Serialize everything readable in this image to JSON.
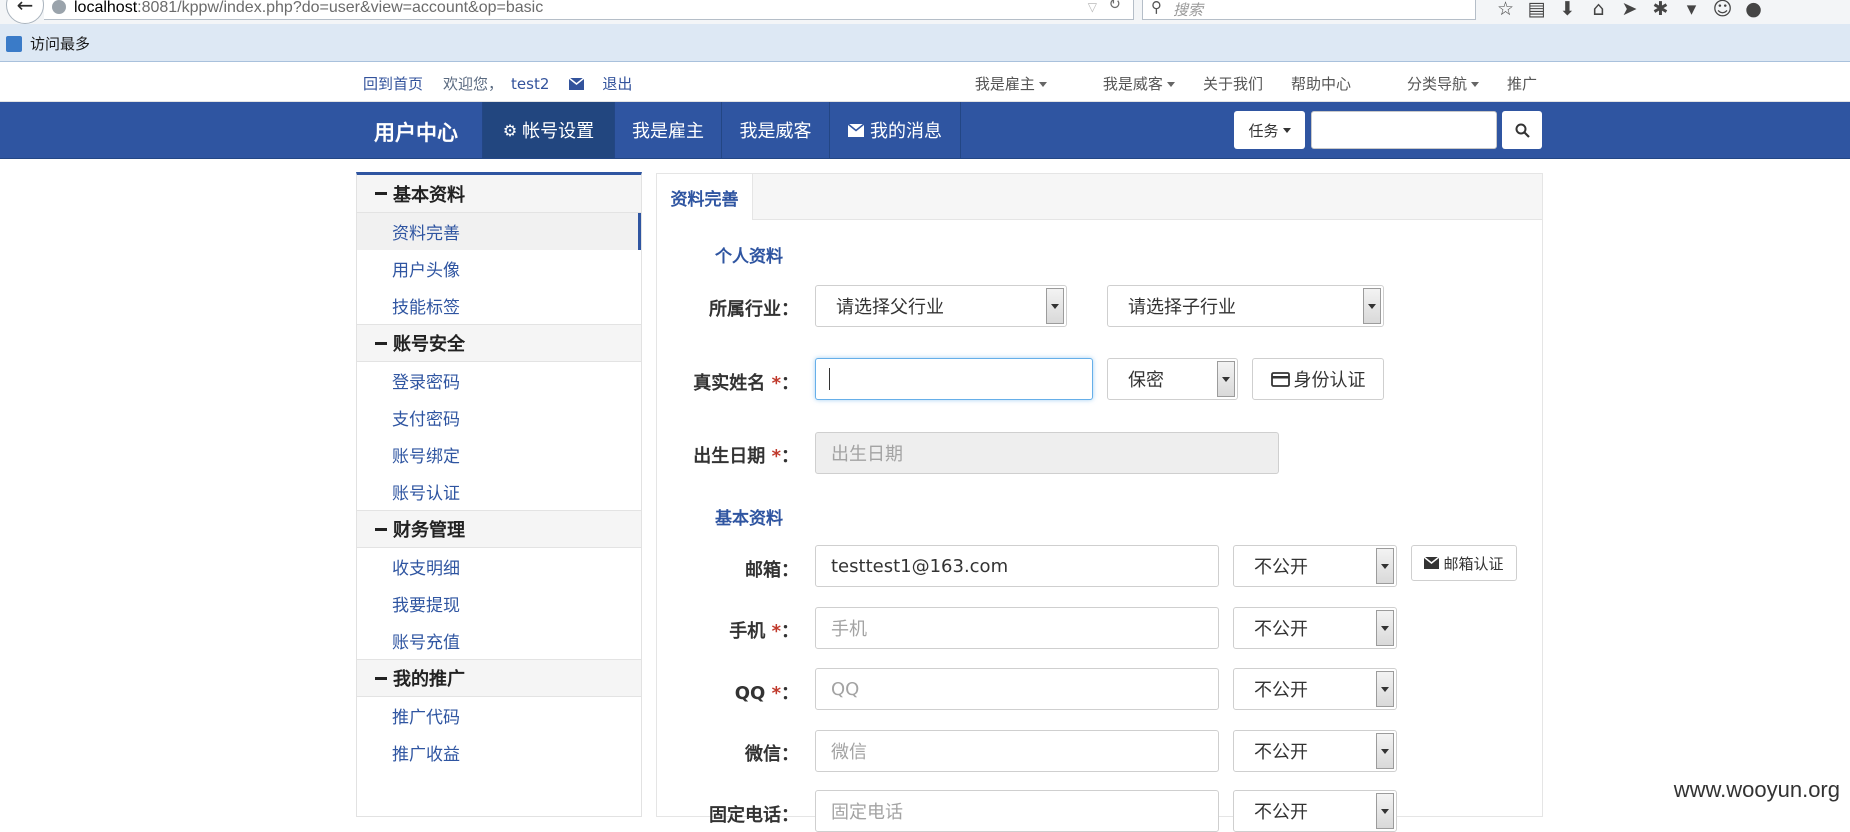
{
  "browser": {
    "url_host": "localhost",
    "url_rest": ":8081/kppw/index.php?do=user&view=account&op=basic",
    "search_placeholder": "搜索",
    "bookmark_label": "访问最多"
  },
  "topbar": {
    "home": "回到首页",
    "welcome": "欢迎您，",
    "username": "test2",
    "logout": "退出",
    "right_items": [
      "我是雇主",
      "我是威客",
      "关于我们",
      "帮助中心",
      "分类导航",
      "推广"
    ]
  },
  "mainnav": {
    "brand": "用户中心",
    "items": [
      "帐号设置",
      "我是雇主",
      "我是威客",
      "我的消息"
    ],
    "task_label": "任务"
  },
  "sidebar": {
    "groups": [
      {
        "title": "基本资料",
        "items": [
          "资料完善",
          "用户头像",
          "技能标签"
        ]
      },
      {
        "title": "账号安全",
        "items": [
          "登录密码",
          "支付密码",
          "账号绑定",
          "账号认证"
        ]
      },
      {
        "title": "财务管理",
        "items": [
          "收支明细",
          "我要提现",
          "账号充值"
        ]
      },
      {
        "title": "我的推广",
        "items": [
          "推广代码",
          "推广收益"
        ]
      }
    ]
  },
  "panel": {
    "tab": "资料完善",
    "personal_title": "个人资料",
    "industry_label": "所属行业：",
    "industry_parent": "请选择父行业",
    "industry_child": "请选择子行业",
    "realname_label": "真实姓名",
    "privacy_secret": "保密",
    "id_verify": "身份认证",
    "birth_label": "出生日期",
    "birth_placeholder": "出生日期",
    "basic_title": "基本资料",
    "email_label": "邮箱：",
    "email_value": "testtest1@163.com",
    "email_verify": "邮箱认证",
    "phone_label": "手机",
    "phone_placeholder": "手机",
    "qq_label": "QQ",
    "qq_placeholder": "QQ",
    "wechat_label": "微信：",
    "wechat_placeholder": "微信",
    "tel_label": "固定电话：",
    "tel_placeholder": "固定电话",
    "visibility": "不公开",
    "required_mark": "*",
    "colon": "："
  },
  "watermark": "www.wooyun.org"
}
